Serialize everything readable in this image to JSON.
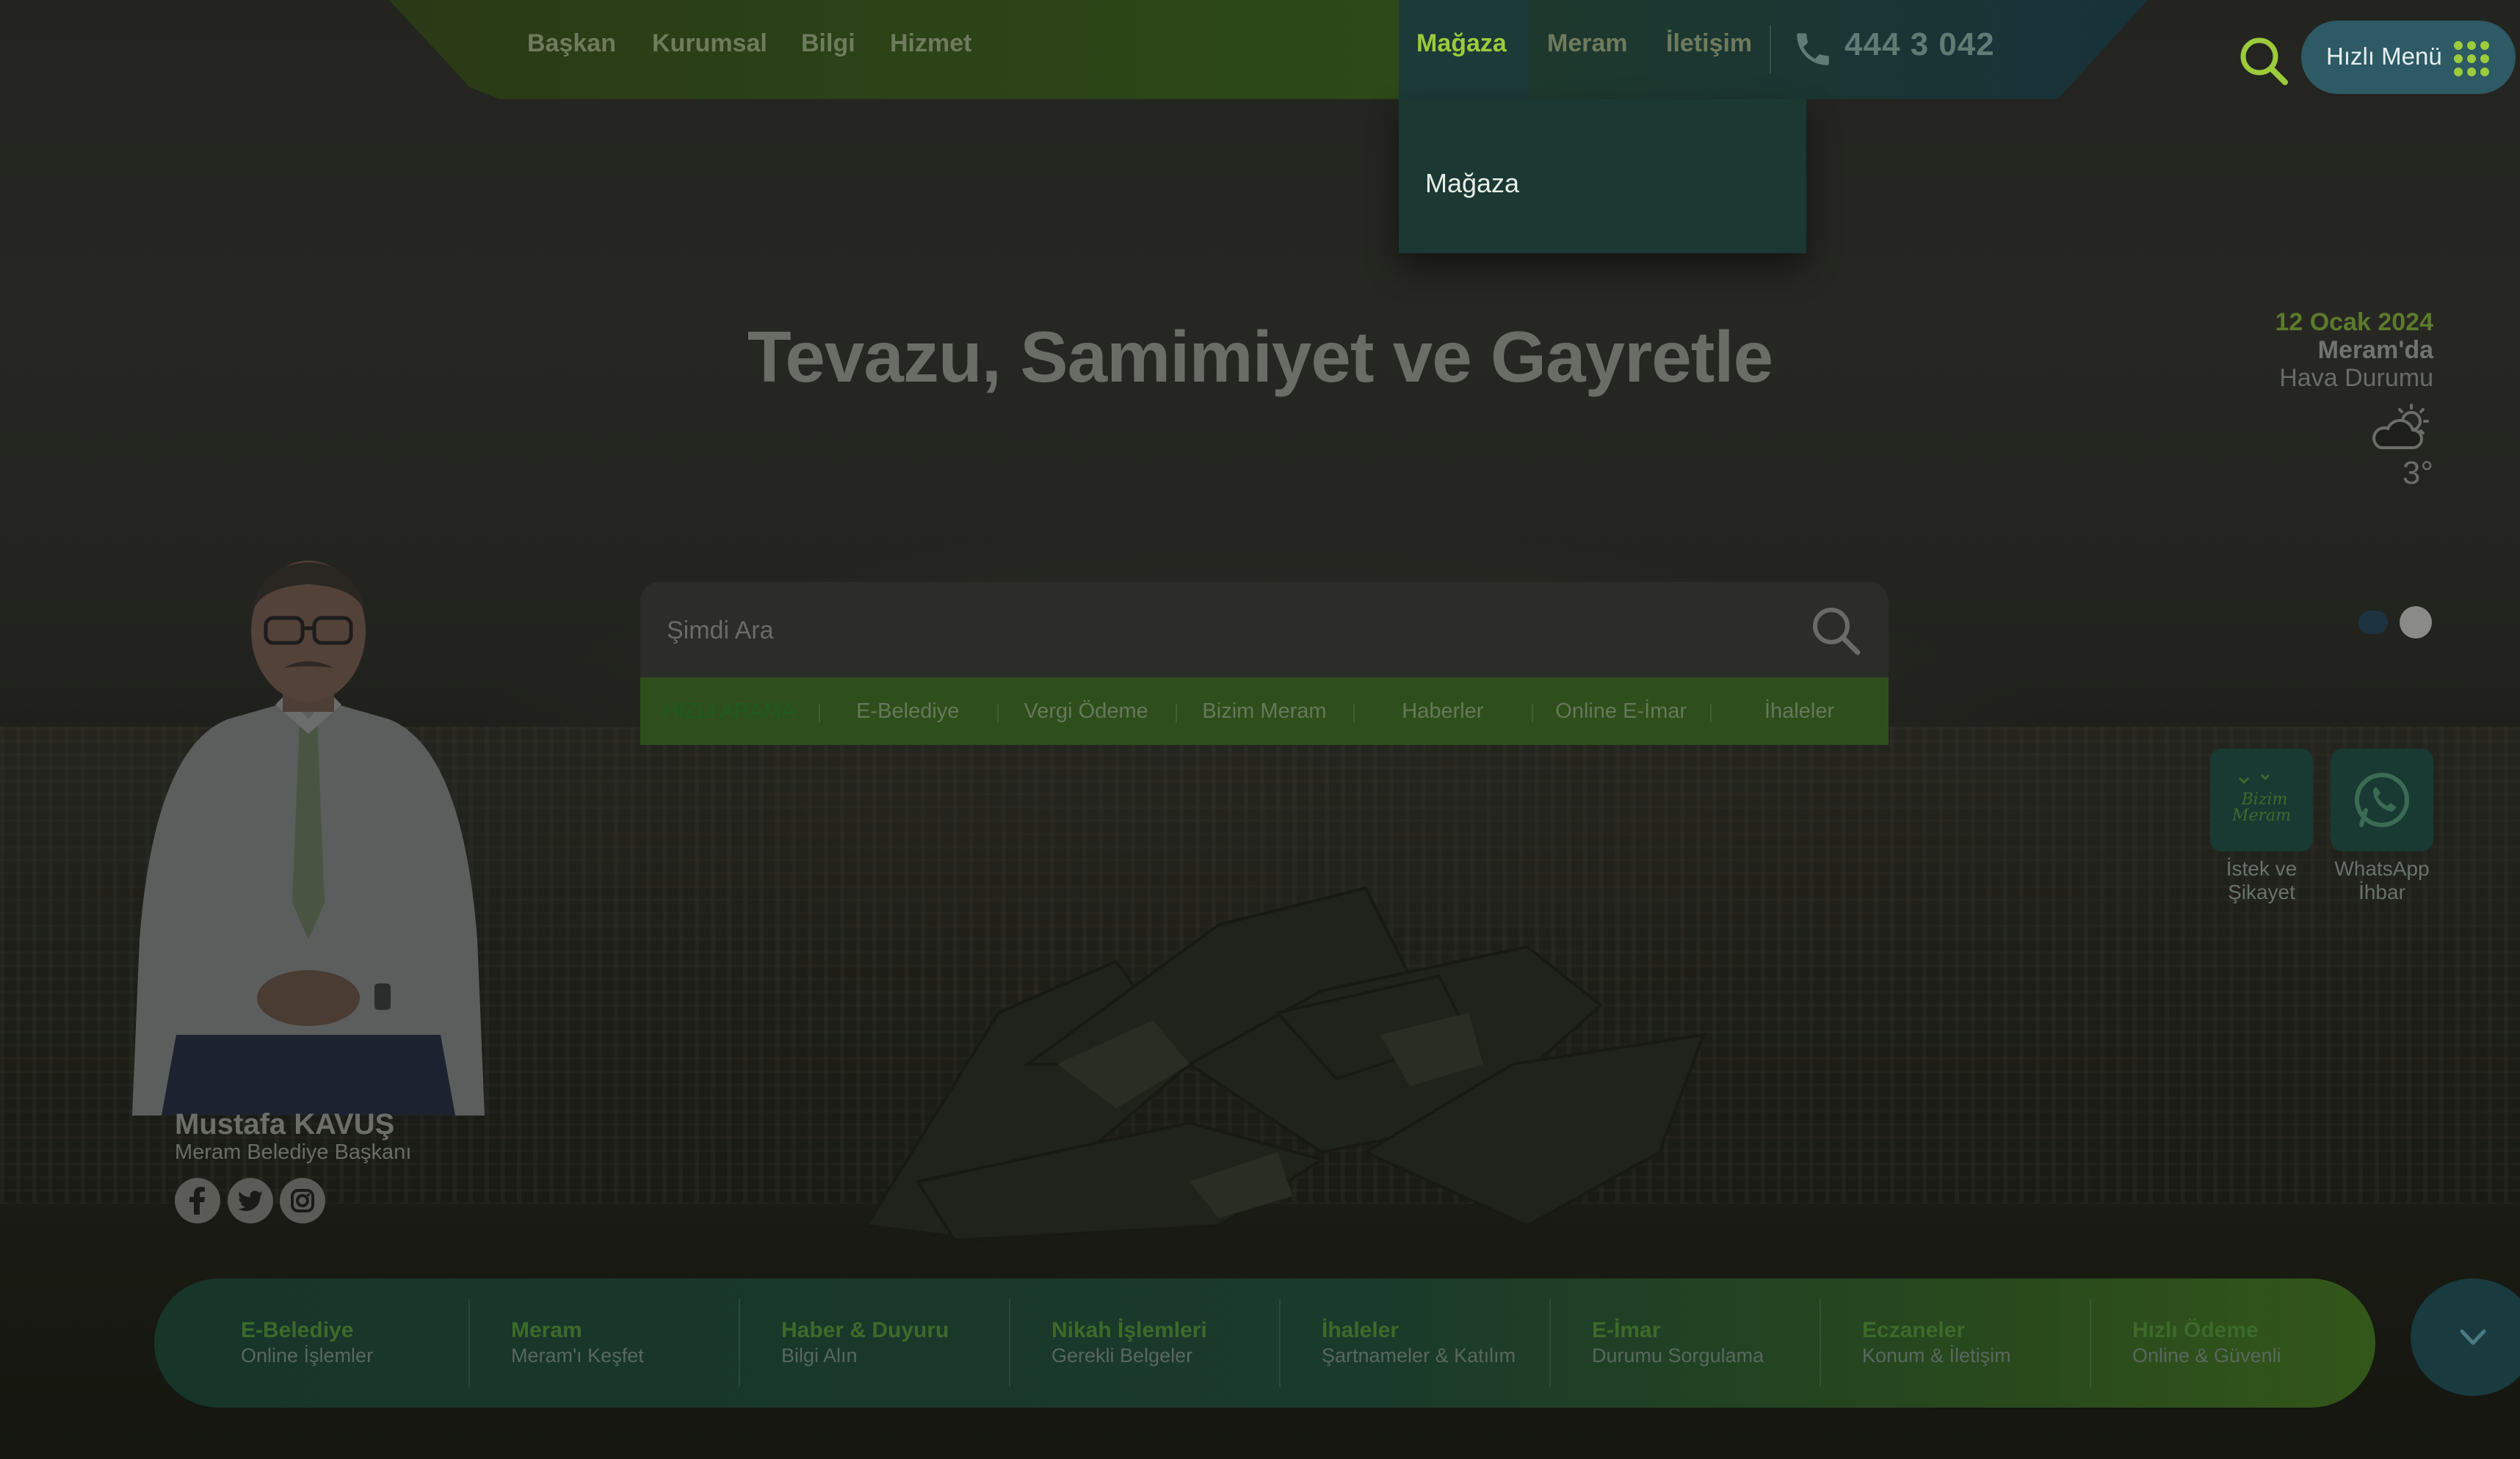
{
  "nav": {
    "links": [
      "Başkan",
      "Kurumsal",
      "Bilgi",
      "Hizmet"
    ],
    "active_link": "Mağaza",
    "right_links": [
      "Meram",
      "İletişim"
    ],
    "phone": "444 3 042",
    "dropdown_item": "Mağaza"
  },
  "quick_menu": {
    "label": "Hızlı Menü"
  },
  "hero": {
    "title": "Tevazu, Samimiyet ve Gayretle"
  },
  "weather": {
    "date": "12 Ocak 2024",
    "place": "Meram'da",
    "label": "Hava Durumu",
    "temperature": "3°",
    "icon": "partly-cloudy-icon"
  },
  "search": {
    "placeholder": "Şimdi Ara",
    "quick_label": "HIZLI ARAMA",
    "quick_items": [
      "E-Belediye",
      "Vergi Ödeme",
      "Bizim Meram",
      "Haberler",
      "Online E-İmar",
      "İhaleler"
    ]
  },
  "side_buttons": [
    {
      "label_line1": "İstek ve",
      "label_line2": "Şikayet",
      "logo_text_1": "Bizim",
      "logo_text_2": "Meram"
    },
    {
      "label_line1": "WhatsApp",
      "label_line2": "İhbar"
    }
  ],
  "mayor": {
    "name": "Mustafa KAVUŞ",
    "title": "Meram Belediye Başkanı",
    "social": [
      "facebook-icon",
      "twitter-icon",
      "instagram-icon"
    ]
  },
  "bottom_bar": [
    {
      "title": "E-Belediye",
      "subtitle": "Online İşlemler"
    },
    {
      "title": "Meram",
      "subtitle": "Meram'ı Keşfet"
    },
    {
      "title": "Haber & Duyuru",
      "subtitle": "Bilgi Alın"
    },
    {
      "title": "Nikah İşlemleri",
      "subtitle": "Gerekli Belgeler"
    },
    {
      "title": "İhaleler",
      "subtitle": "Şartnameler & Katılım"
    },
    {
      "title": "E-İmar",
      "subtitle": "Durumu Sorgulama"
    },
    {
      "title": "Eczaneler",
      "subtitle": "Konum & İletişim"
    },
    {
      "title": "Hızlı Ödeme",
      "subtitle": "Online & Güvenli"
    }
  ],
  "colors": {
    "accent_green": "#9ccb3b",
    "dark_teal": "#1b3833",
    "quick_menu_bg": "#2d5a64"
  }
}
